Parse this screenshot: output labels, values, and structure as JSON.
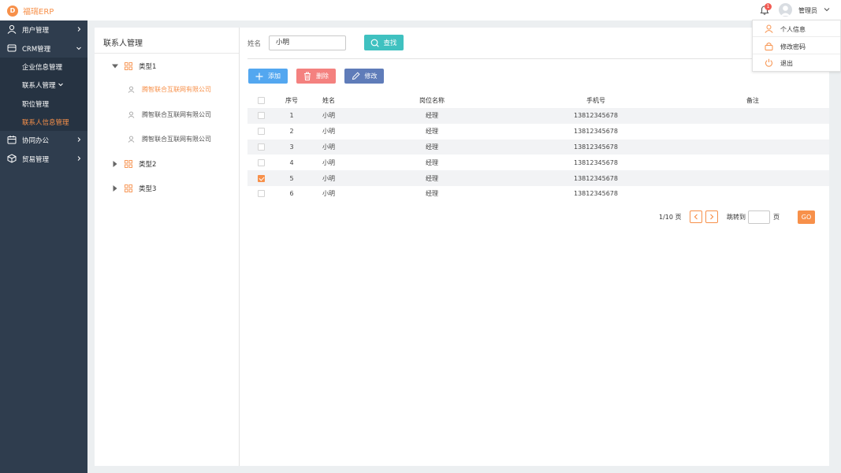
{
  "app": {
    "logo_letter": "D",
    "name": "福瑞ERP"
  },
  "header": {
    "notification_count": "1",
    "username": "管理员"
  },
  "user_menu": [
    {
      "label": "个人信息",
      "icon": "user-icon"
    },
    {
      "label": "修改密码",
      "icon": "lock-icon"
    },
    {
      "label": "退出",
      "icon": "power-icon"
    }
  ],
  "sidebar": {
    "items": [
      {
        "label": "用户管理",
        "icon": "user-icon"
      },
      {
        "label": "CRM管理",
        "icon": "crm-icon"
      },
      {
        "label": "协同办公",
        "icon": "calendar-icon"
      },
      {
        "label": "贸易管理",
        "icon": "cube-icon"
      }
    ],
    "crm_sub": [
      {
        "label": "企业信息管理"
      },
      {
        "label": "联系人管理"
      },
      {
        "label": "职位管理"
      },
      {
        "label": "联系人信息管理",
        "active": true
      }
    ]
  },
  "tree": {
    "title": "联系人管理",
    "types": [
      "类型1",
      "类型2",
      "类型3"
    ],
    "leaves": [
      "腾智联合互联网有限公司",
      "腾智联合互联网有限公司",
      "腾智联合互联网有限公司"
    ]
  },
  "search": {
    "label": "姓名",
    "value": "小明",
    "button": "查找"
  },
  "actions": {
    "add": "添加",
    "delete": "删除",
    "edit": "修改"
  },
  "table": {
    "headers": [
      "序号",
      "姓名",
      "岗位名称",
      "手机号",
      "备注"
    ],
    "rows": [
      {
        "no": "1",
        "name": "小明",
        "position": "经理",
        "phone": "13812345678",
        "note": "",
        "checked": false
      },
      {
        "no": "2",
        "name": "小明",
        "position": "经理",
        "phone": "13812345678",
        "note": "",
        "checked": false
      },
      {
        "no": "3",
        "name": "小明",
        "position": "经理",
        "phone": "13812345678",
        "note": "",
        "checked": false
      },
      {
        "no": "4",
        "name": "小明",
        "position": "经理",
        "phone": "13812345678",
        "note": "",
        "checked": false
      },
      {
        "no": "5",
        "name": "小明",
        "position": "经理",
        "phone": "13812345678",
        "note": "",
        "checked": true
      },
      {
        "no": "6",
        "name": "小明",
        "position": "经理",
        "phone": "13812345678",
        "note": "",
        "checked": false
      }
    ]
  },
  "pagination": {
    "info": "1/10 页",
    "jump_label": "跳转到",
    "unit": "页",
    "go": "GO"
  },
  "colors": {
    "accent": "#f7904a",
    "sidebar": "#2f3d4e",
    "teal": "#3fc1c0",
    "blue": "#53a7f0",
    "red": "#f4817f",
    "navy": "#5f7cb9"
  }
}
